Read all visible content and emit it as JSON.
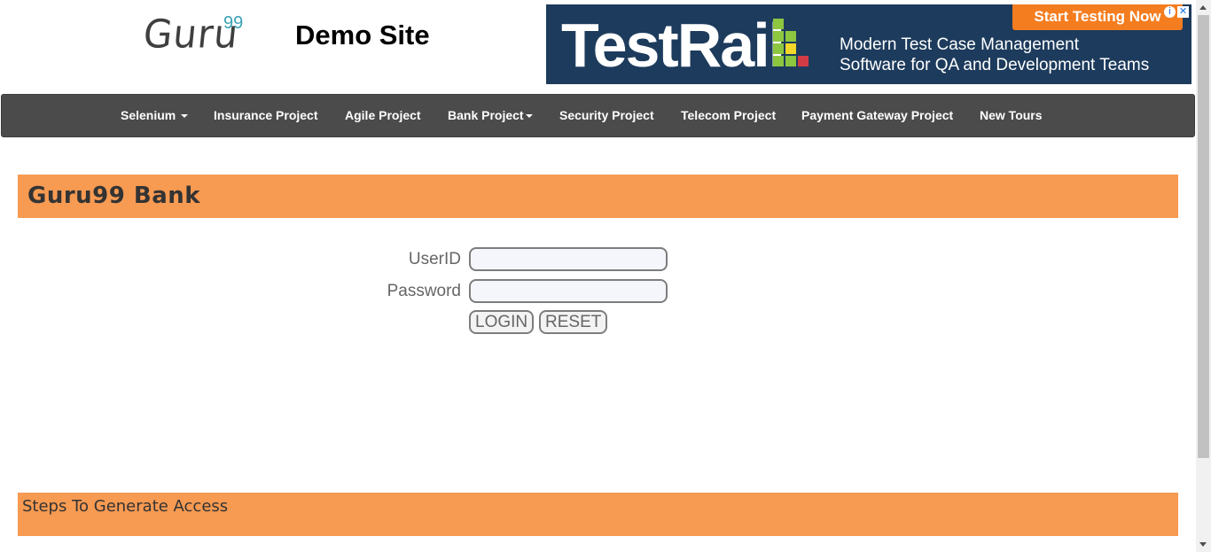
{
  "header": {
    "logo_text": "Guru",
    "logo_superscript": "99",
    "site_title": "Demo Site"
  },
  "ad": {
    "brand": "TestRail",
    "tagline_line1": "Modern Test Case Management",
    "tagline_line2": "Software for QA and Development Teams",
    "cta": "Start Testing Now",
    "info_icon": "info-icon",
    "close_icon": "close-icon",
    "colors": {
      "background": "#1d3b5c",
      "cta": "#f47d20"
    }
  },
  "nav": {
    "items": [
      {
        "label": "Selenium",
        "dropdown": true
      },
      {
        "label": "Insurance Project",
        "dropdown": false
      },
      {
        "label": "Agile Project",
        "dropdown": false
      },
      {
        "label": "Bank Project",
        "dropdown": true
      },
      {
        "label": "Security Project",
        "dropdown": false
      },
      {
        "label": "Telecom Project",
        "dropdown": false
      },
      {
        "label": "Payment Gateway Project",
        "dropdown": false
      },
      {
        "label": "New Tours",
        "dropdown": false
      }
    ]
  },
  "bank": {
    "title": "Guru99 Bank"
  },
  "form": {
    "userid_label": "UserID",
    "userid_value": "",
    "password_label": "Password",
    "password_value": "",
    "login_label": "LOGIN",
    "reset_label": "RESET"
  },
  "footer": {
    "steps_title": "Steps To Generate Access"
  },
  "colors": {
    "nav_background": "#4b4b4b",
    "accent_bar": "#f79a52"
  }
}
